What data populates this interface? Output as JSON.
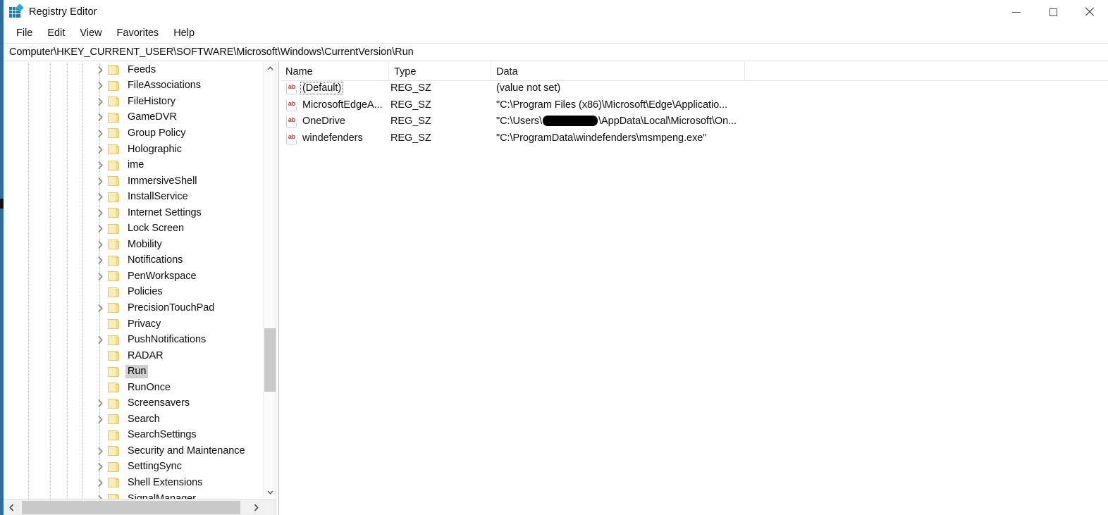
{
  "window": {
    "title": "Registry Editor",
    "icon": "registry-editor-icon",
    "controls": {
      "minimize": "minimize-icon",
      "maximize": "maximize-icon",
      "close": "close-icon"
    }
  },
  "menubar": {
    "items": [
      {
        "label": "File"
      },
      {
        "label": "Edit"
      },
      {
        "label": "View"
      },
      {
        "label": "Favorites"
      },
      {
        "label": "Help"
      }
    ]
  },
  "address": {
    "path": "Computer\\HKEY_CURRENT_USER\\SOFTWARE\\Microsoft\\Windows\\CurrentVersion\\Run"
  },
  "tree": {
    "selected": "Run",
    "items": [
      {
        "label": "Feeds",
        "expandable": true,
        "selected": false
      },
      {
        "label": "FileAssociations",
        "expandable": true,
        "selected": false
      },
      {
        "label": "FileHistory",
        "expandable": true,
        "selected": false
      },
      {
        "label": "GameDVR",
        "expandable": true,
        "selected": false
      },
      {
        "label": "Group Policy",
        "expandable": true,
        "selected": false
      },
      {
        "label": "Holographic",
        "expandable": true,
        "selected": false
      },
      {
        "label": "ime",
        "expandable": true,
        "selected": false
      },
      {
        "label": "ImmersiveShell",
        "expandable": true,
        "selected": false
      },
      {
        "label": "InstallService",
        "expandable": true,
        "selected": false
      },
      {
        "label": "Internet Settings",
        "expandable": true,
        "selected": false
      },
      {
        "label": "Lock Screen",
        "expandable": true,
        "selected": false
      },
      {
        "label": "Mobility",
        "expandable": true,
        "selected": false
      },
      {
        "label": "Notifications",
        "expandable": true,
        "selected": false
      },
      {
        "label": "PenWorkspace",
        "expandable": true,
        "selected": false
      },
      {
        "label": "Policies",
        "expandable": false,
        "selected": false
      },
      {
        "label": "PrecisionTouchPad",
        "expandable": true,
        "selected": false
      },
      {
        "label": "Privacy",
        "expandable": false,
        "selected": false
      },
      {
        "label": "PushNotifications",
        "expandable": true,
        "selected": false
      },
      {
        "label": "RADAR",
        "expandable": false,
        "selected": false
      },
      {
        "label": "Run",
        "expandable": false,
        "selected": true
      },
      {
        "label": "RunOnce",
        "expandable": false,
        "selected": false
      },
      {
        "label": "Screensavers",
        "expandable": true,
        "selected": false
      },
      {
        "label": "Search",
        "expandable": true,
        "selected": false
      },
      {
        "label": "SearchSettings",
        "expandable": false,
        "selected": false
      },
      {
        "label": "Security and Maintenance",
        "expandable": true,
        "selected": false
      },
      {
        "label": "SettingSync",
        "expandable": true,
        "selected": false
      },
      {
        "label": "Shell Extensions",
        "expandable": true,
        "selected": false
      },
      {
        "label": "SignalManager",
        "expandable": true,
        "selected": false
      }
    ]
  },
  "list": {
    "columns": [
      "Name",
      "Type",
      "Data"
    ],
    "rows": [
      {
        "name": "(Default)",
        "type": "REG_SZ",
        "data": "(value not set)",
        "icon": "string-value-icon",
        "focused": true,
        "redacted": false
      },
      {
        "name": "MicrosoftEdgeA...",
        "type": "REG_SZ",
        "data": "\"C:\\Program Files (x86)\\Microsoft\\Edge\\Applicatio...",
        "icon": "string-value-icon",
        "focused": false,
        "redacted": false
      },
      {
        "name": "OneDrive",
        "type": "REG_SZ",
        "data_before": "\"C:\\Users\\",
        "data_after": "\\AppData\\Local\\Microsoft\\On...",
        "icon": "string-value-icon",
        "focused": false,
        "redacted": true
      },
      {
        "name": "windefenders",
        "type": "REG_SZ",
        "data": "\"C:\\ProgramData\\windefenders\\msmpeng.exe\"",
        "icon": "string-value-icon",
        "focused": false,
        "redacted": false
      }
    ]
  },
  "scrollbars": {
    "tree_vertical": {
      "up": "chevron-up-icon",
      "down": "chevron-down-icon"
    },
    "tree_horizontal": {
      "left": "chevron-left-icon",
      "right": "chevron-right-icon"
    }
  },
  "colors": {
    "accent": "#2e6d9e",
    "folder": "#fcedb6",
    "selection": "#cfcfcf",
    "string_icon": "#c0392b"
  }
}
